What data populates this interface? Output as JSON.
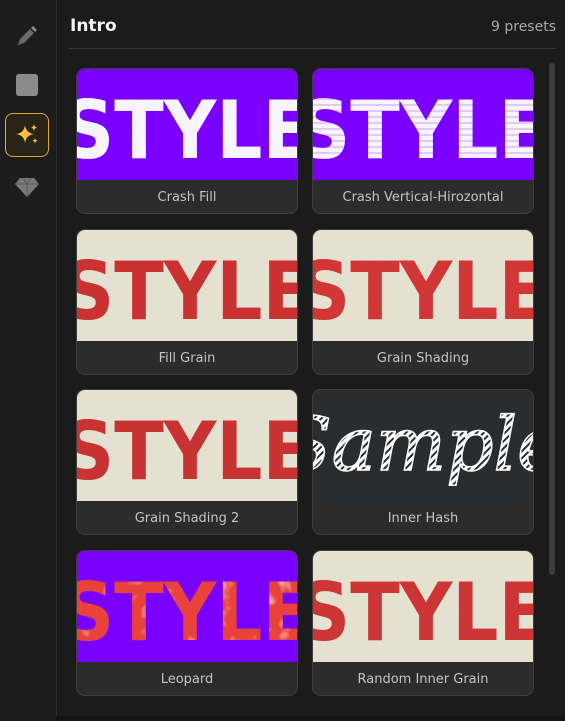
{
  "toolbar": {
    "tools": [
      {
        "icon": "eyedropper-icon",
        "active": false
      },
      {
        "icon": "square-icon",
        "active": false
      },
      {
        "icon": "sparkles-icon",
        "active": true
      },
      {
        "icon": "diamond-icon",
        "active": false
      }
    ]
  },
  "panel": {
    "title": "Intro",
    "count": "9 presets"
  },
  "presets": [
    {
      "label": "Crash Fill",
      "thumb_text": "STYLE",
      "style": "crash",
      "bg": "#7a00ff",
      "fg": "#ffffff"
    },
    {
      "label": "Crash Vertical-Hirozontal",
      "thumb_text": "STYLE",
      "style": "crash-lines",
      "bg": "#7a00ff",
      "fg": "#ffffff"
    },
    {
      "label": "Fill Grain",
      "thumb_text": "STYLE",
      "style": "grain",
      "bg": "#e4e1d1",
      "fg": "#d72a2a"
    },
    {
      "label": "Grain Shading",
      "thumb_text": "STYLE",
      "style": "grain",
      "bg": "#e4e1d1",
      "fg": "#e23232"
    },
    {
      "label": "Grain Shading 2",
      "thumb_text": "STYLE",
      "style": "grain",
      "bg": "#e4e1d1",
      "fg": "#d42c2c"
    },
    {
      "label": "Inner Hash",
      "thumb_text": "Sample",
      "style": "script",
      "bg": "#2a2d2f",
      "fg": "#ffffff"
    },
    {
      "label": "Leopard",
      "thumb_text": "STYLE",
      "style": "leopard",
      "bg": "#7a00ff",
      "fg": "#e8423a"
    },
    {
      "label": "Random Inner Grain",
      "thumb_text": "STYLE",
      "style": "grain",
      "bg": "#e4e1d1",
      "fg": "#db3030"
    }
  ]
}
